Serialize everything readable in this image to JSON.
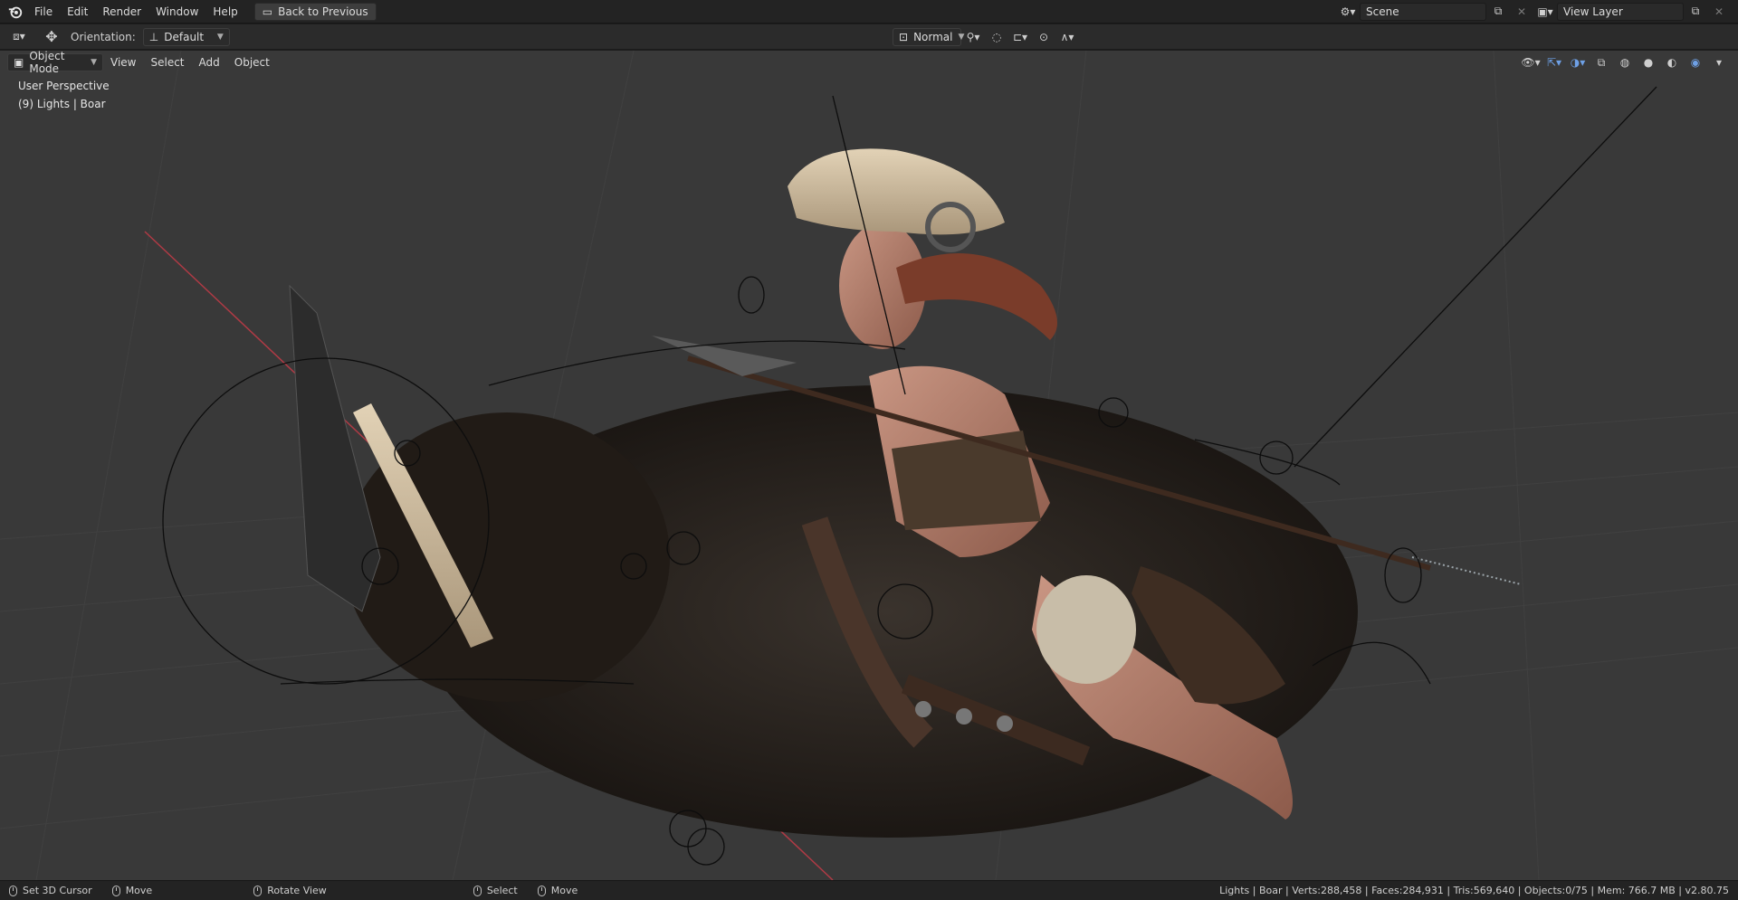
{
  "topbar": {
    "menu": [
      "File",
      "Edit",
      "Render",
      "Window",
      "Help"
    ],
    "back_button": "Back to Previous",
    "scene_name": "Scene",
    "view_layer_name": "View Layer"
  },
  "toolbar": {
    "orientation_label": "Orientation:",
    "orientation_value": "Default",
    "pivot_value": "Normal"
  },
  "viewport_header": {
    "mode": "Object Mode",
    "menus": [
      "View",
      "Select",
      "Add",
      "Object"
    ]
  },
  "viewport": {
    "view_name": "User Perspective",
    "active_info": "(9) Lights | Boar"
  },
  "statusbar": {
    "items": [
      "Set 3D Cursor",
      "Move",
      "Rotate View",
      "Select",
      "Move"
    ],
    "stats": "Lights | Boar | Verts:288,458 | Faces:284,931 | Tris:569,640 | Objects:0/75 | Mem: 766.7 MB | v2.80.75"
  },
  "icons": [
    "blender-logo-icon",
    "back-icon",
    "transform-icon",
    "scene-icon",
    "view-layer-icon",
    "snap-icon",
    "proportional-icon",
    "shading-solid-icon",
    "shading-material-icon",
    "shading-rendered-icon",
    "overlay-icon",
    "gizmo-icon"
  ],
  "colors": {
    "accent": "#4772b3",
    "viewport_bg": "#393939",
    "grid_x_axis": "#b03a45"
  }
}
